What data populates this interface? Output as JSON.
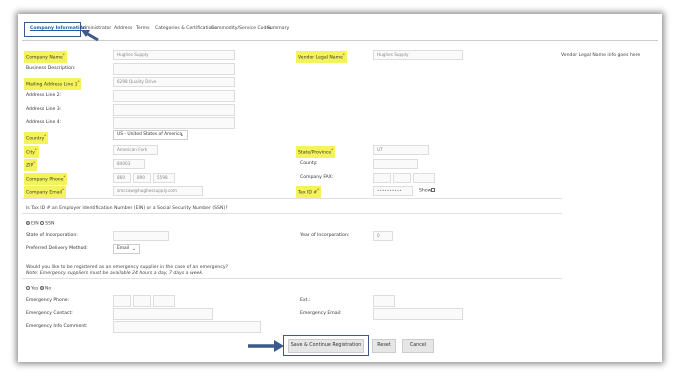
{
  "tabs": [
    "Company Information",
    "Administrator",
    "Address",
    "Terms",
    "Categories & Certifications",
    "Commodity/Service Codes",
    "Summary"
  ],
  "form": {
    "company_name": {
      "label": "Company Name",
      "value": "Hughes Supply"
    },
    "vendor_legal_name": {
      "label": "Vendor Legal Name",
      "value": "Hughes Supply"
    },
    "vendor_legal_info": "Vendor Legal Name info goes here",
    "business_description": {
      "label": "Business Description:"
    },
    "mailing_address_1": {
      "label": "Mailing Address Line 1",
      "value": "6298 Quality Drive"
    },
    "address_2": {
      "label": "Address Line 2:"
    },
    "address_3": {
      "label": "Address Line 3:"
    },
    "address_4": {
      "label": "Address Line 4:"
    },
    "country": {
      "label": "Country",
      "value": "US - United States of America"
    },
    "city": {
      "label": "City",
      "value": "American Fork"
    },
    "state": {
      "label": "State/Province",
      "value": "UT"
    },
    "zip": {
      "label": "ZIP",
      "value": "84003"
    },
    "county": {
      "label": "County:"
    },
    "company_phone": {
      "label": "Company Phone",
      "area": "860",
      "prefix": "890",
      "line": "5598"
    },
    "company_fax": {
      "label": "Company FAX:"
    },
    "company_email": {
      "label": "Company Email",
      "value": "smccaw@hughessupply.com"
    },
    "tax_id": {
      "label": "Tax ID #",
      "value": "••••••••••",
      "show_label": "Show"
    },
    "tax_question": "Is Tax ID # an Employer Identification Number (EIN) or a Social Security Number (SSN)?",
    "tax_options": [
      "EIN",
      "SSN"
    ],
    "state_incorp": {
      "label": "State of Incorporation:"
    },
    "year_incorp": {
      "label": "Year of Incorporation:",
      "value": "0"
    },
    "delivery_method": {
      "label": "Preferred Delivery Method:",
      "value": "Email"
    },
    "emergency_question": "Would you like to be registered as an emergency supplier in the case of an emergency?",
    "emergency_note": "Note: Emergency suppliers must be available 24 hours a day, 7 days a week.",
    "emergency_options": [
      "Yes",
      "No"
    ],
    "emergency_phone": {
      "label": "Emergency Phone:"
    },
    "ext": {
      "label": "Ext.:"
    },
    "emergency_contact": {
      "label": "Emergency Contact:"
    },
    "emergency_email": {
      "label": "Emergency Email:"
    },
    "emergency_comment": {
      "label": "Emergency Info Comment:"
    }
  },
  "buttons": {
    "save": "Save & Continue Registration",
    "reset": "Reset",
    "cancel": "Cancel"
  },
  "colors": {
    "required_highlight": "#f4f45a",
    "tab_active": "#1f5fa8",
    "callout": "#3a5a8a"
  }
}
